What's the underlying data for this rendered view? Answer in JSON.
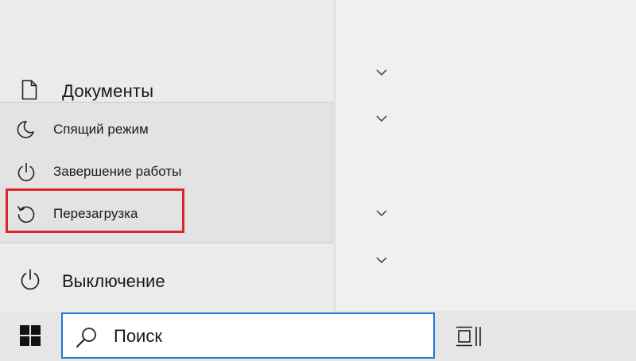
{
  "start_menu": {
    "documents_label": "Документы",
    "power_menu": {
      "items": [
        {
          "label": "Спящий режим",
          "icon": "moon-icon"
        },
        {
          "label": "Завершение работы",
          "icon": "power-icon"
        },
        {
          "label": "Перезагрузка",
          "icon": "restart-icon",
          "highlighted": true
        }
      ]
    },
    "shutdown_label": "Выключение"
  },
  "taskbar": {
    "search_placeholder": "Поиск",
    "icons": [
      "windows-logo-icon",
      "search-icon",
      "task-view-icon"
    ]
  },
  "colors": {
    "highlight_border": "#e0242f",
    "search_border": "#1a78d4"
  }
}
